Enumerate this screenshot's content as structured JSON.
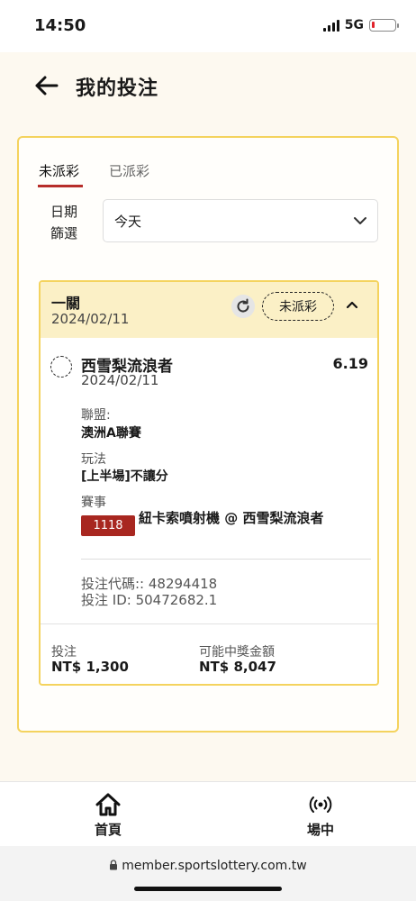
{
  "status_bar": {
    "time": "14:50",
    "network": "5G"
  },
  "header": {
    "title": "我的投注"
  },
  "tabs": [
    {
      "label": "未派彩",
      "active": true
    },
    {
      "label": "已派彩",
      "active": false
    }
  ],
  "filter": {
    "label_line1": "日期",
    "label_line2": "篩選",
    "value": "今天"
  },
  "bet": {
    "type": "一關",
    "date": "2024/02/11",
    "status": "未派彩",
    "selection": {
      "name": "西雪梨流浪者",
      "odds": "6.19",
      "date": "2024/02/11"
    },
    "league_label": "聯盟:",
    "league_value": "澳洲A聯賽",
    "play_label": "玩法",
    "play_value": "[上半場]不讓分",
    "match_label": "賽事",
    "match_id": "1118",
    "match_name": "紐卡索噴射機 @ 西雪梨流浪者",
    "bet_code": "投注代碼:: 48294418",
    "bet_id": "投注 ID: 50472682.1",
    "stake_label": "投注",
    "stake_value": "NT$ 1,300",
    "win_label": "可能中獎金額",
    "win_value": "NT$ 8,047"
  },
  "bottom_nav": [
    {
      "label": "首頁",
      "icon": "home-icon"
    },
    {
      "label": "場中",
      "icon": "broadcast-icon"
    }
  ],
  "url": "member.sportslottery.com.tw",
  "colors": {
    "accent_yellow": "#f4d35e",
    "accent_red": "#a82720",
    "header_bg": "#fbf0c6"
  }
}
